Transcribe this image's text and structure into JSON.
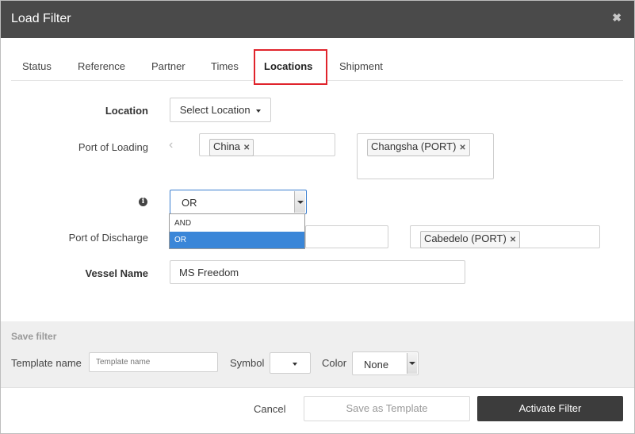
{
  "dialog": {
    "title": "Load Filter",
    "close_icon": "close-icon"
  },
  "tabs": [
    {
      "label": "Status"
    },
    {
      "label": "Reference"
    },
    {
      "label": "Partner"
    },
    {
      "label": "Times"
    },
    {
      "label": "Locations",
      "active": true
    },
    {
      "label": "Shipment"
    }
  ],
  "form": {
    "location_label": "Location",
    "select_location_button": "Select Location",
    "port_loading_label": "Port of Loading",
    "port_loading_chip": "China",
    "port_loading_chip2": "Changsha (PORT)",
    "operator_value": "OR",
    "operator_options": [
      "AND",
      "OR"
    ],
    "port_discharge_label": "Port of Discharge",
    "port_discharge_chip": "Cabedelo (PORT)",
    "vessel_label": "Vessel Name",
    "vessel_value": "MS Freedom"
  },
  "save": {
    "heading": "Save filter",
    "template_label": "Template name",
    "template_placeholder": "Template name",
    "symbol_label": "Symbol",
    "color_label": "Color",
    "color_value": "None"
  },
  "footer": {
    "cancel": "Cancel",
    "save_template": "Save as Template",
    "activate": "Activate Filter"
  },
  "colors": {
    "titlebar": "#4a4a4a",
    "highlight": "#e0242c",
    "selected": "#3a86d8",
    "primary_button": "#3c3c3c"
  }
}
